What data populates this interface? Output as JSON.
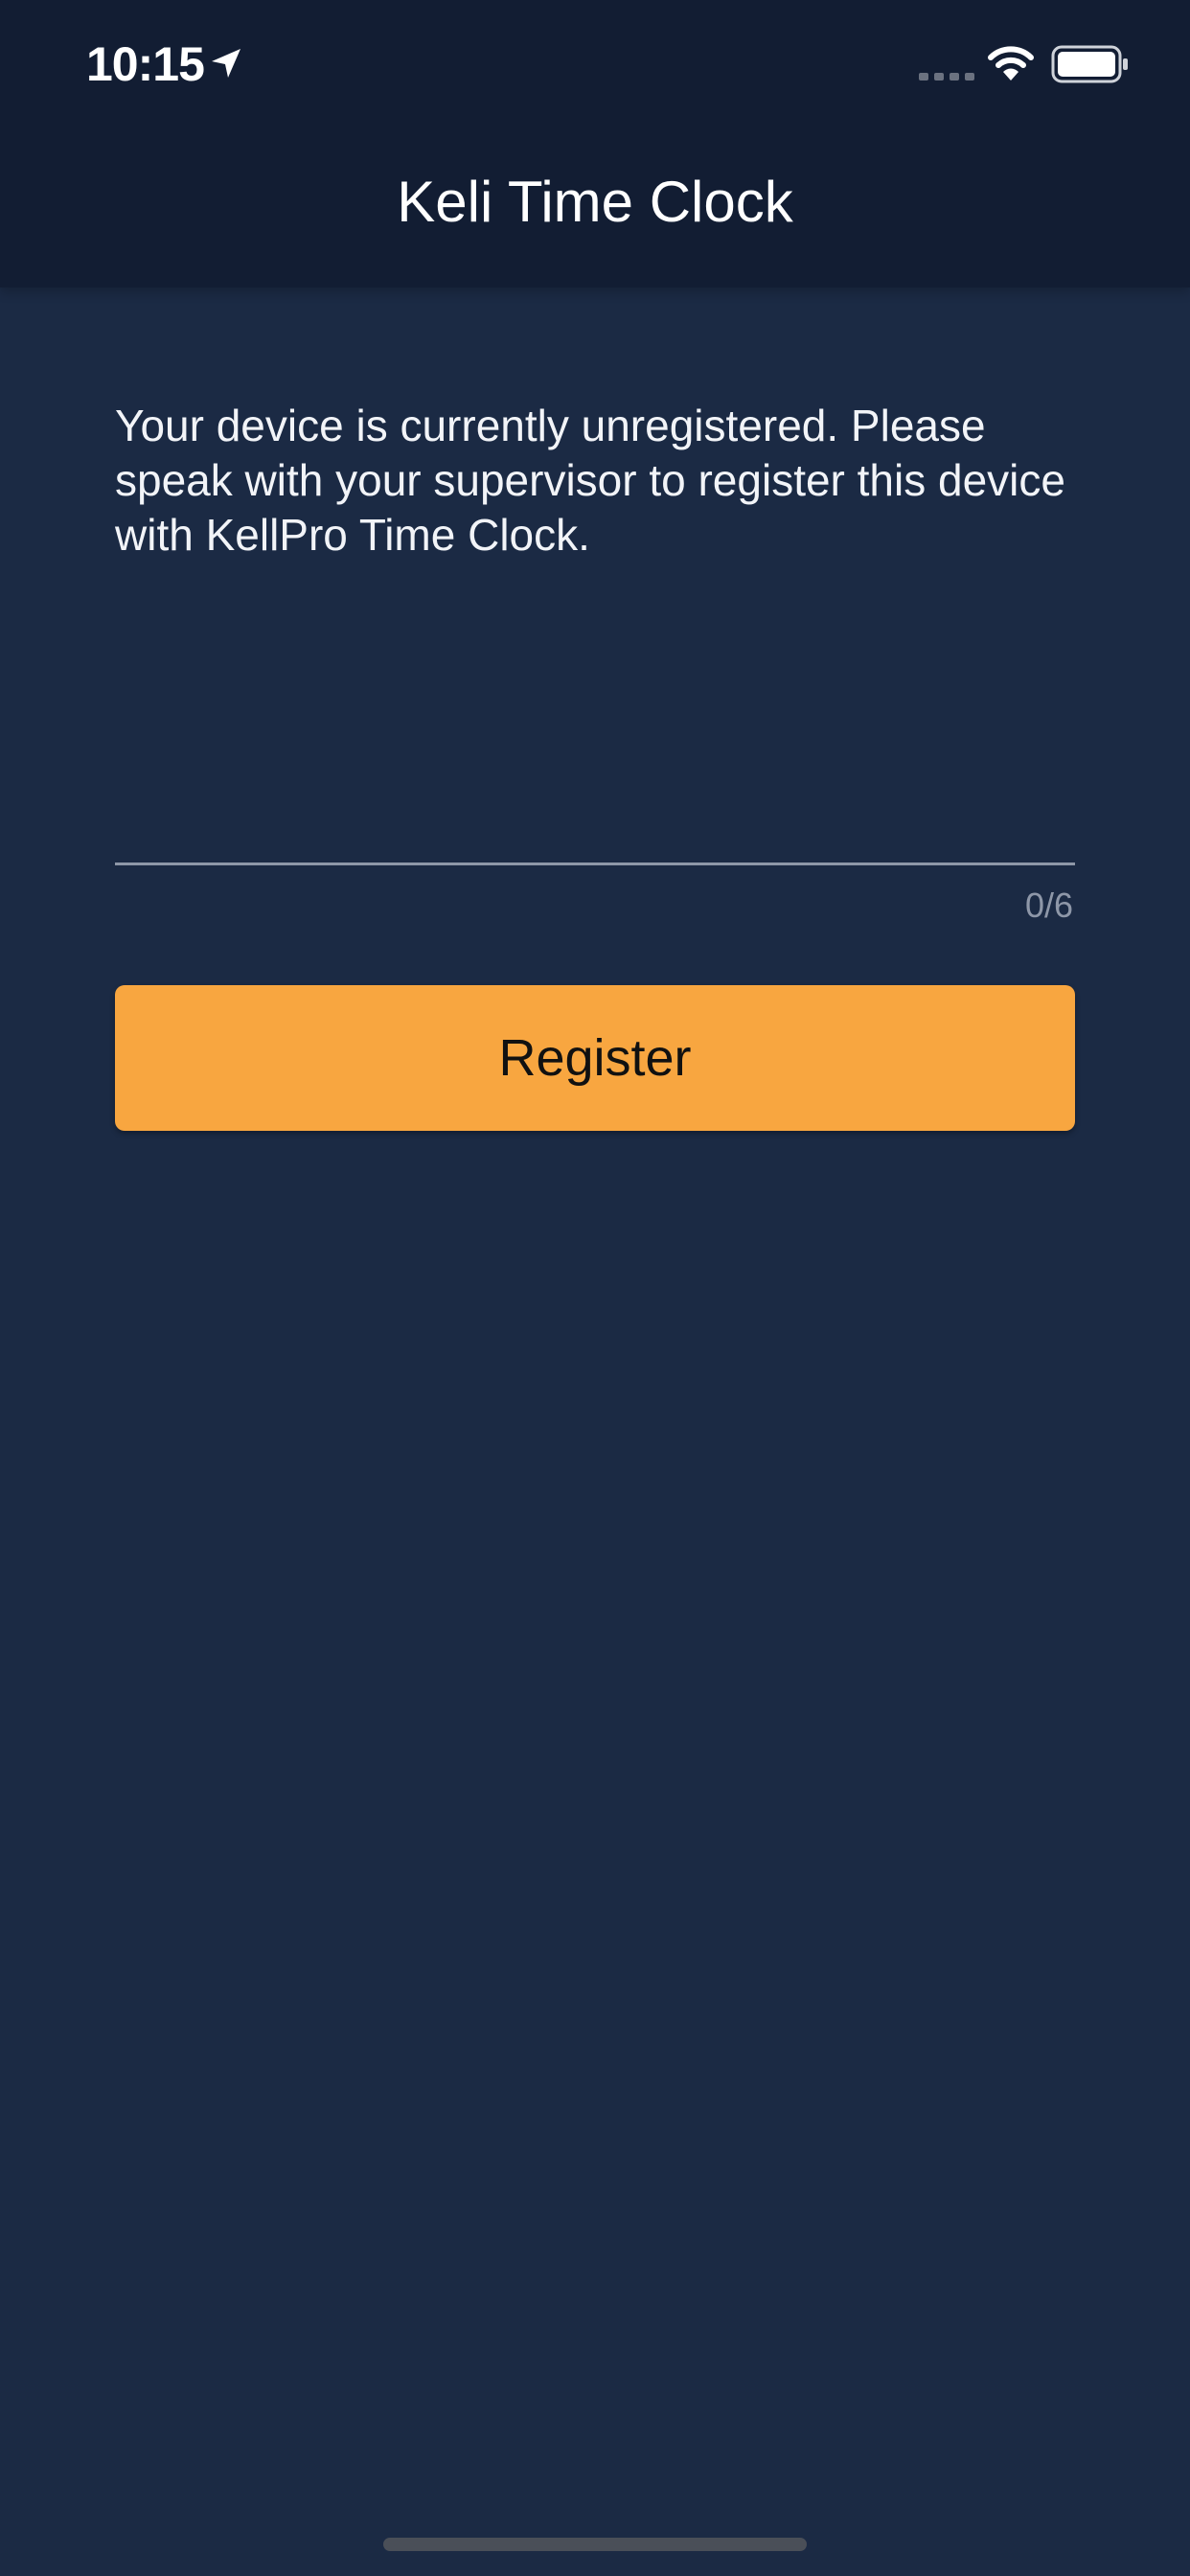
{
  "status_bar": {
    "time": "10:15",
    "icons": [
      "location-arrow-icon",
      "signal-icon",
      "wifi-icon",
      "battery-icon"
    ]
  },
  "header": {
    "title": "Keli Time Clock"
  },
  "main": {
    "message": "Your device is currently unregistered. Please speak with your supervisor to register this device with KellPro Time Clock.",
    "code_input": {
      "value": "",
      "placeholder": ""
    },
    "char_counter": "0/6",
    "register_button_label": "Register"
  },
  "colors": {
    "background": "#1b2a44",
    "header": "#121d33",
    "accent": "#f8a640",
    "muted": "#8e97a8"
  }
}
